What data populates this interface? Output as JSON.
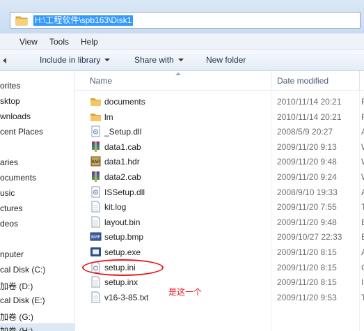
{
  "address": {
    "path": "H:\\工程软件\\spb163\\Disk1"
  },
  "menu": {
    "items": [
      "View",
      "Tools",
      "Help"
    ]
  },
  "toolbar": {
    "include_library": "Include in library",
    "share_with": "Share with",
    "new_folder": "New folder"
  },
  "nav": {
    "items": [
      "orites",
      "sktop",
      "wnloads",
      "cent Places",
      "aries",
      "ocuments",
      "usic",
      "ctures",
      "deos",
      "nputer",
      "cal Disk (C:)",
      "加卷 (D:)",
      "cal Disk (E:)",
      "加卷 (G:)",
      "加卷 (H:)"
    ],
    "selected_index": 14
  },
  "columns": {
    "name": "Name",
    "date": "Date modified"
  },
  "files": [
    {
      "name": "documents",
      "date": "2010/11/14 20:21",
      "type_letter": "F",
      "icon": "folder-icon"
    },
    {
      "name": "lm",
      "date": "2010/11/14 20:21",
      "type_letter": "F",
      "icon": "folder-icon"
    },
    {
      "name": "_Setup.dll",
      "date": "2008/5/9 20:27",
      "type_letter": "A",
      "icon": "dll-icon"
    },
    {
      "name": "data1.cab",
      "date": "2009/11/20 9:13",
      "type_letter": "W",
      "icon": "cab-archive-icon"
    },
    {
      "name": "data1.hdr",
      "date": "2009/11/20 9:48",
      "type_letter": "W",
      "icon": "hdr-archive-icon"
    },
    {
      "name": "data2.cab",
      "date": "2009/11/20 9:24",
      "type_letter": "W",
      "icon": "cab-archive-icon"
    },
    {
      "name": "ISSetup.dll",
      "date": "2008/9/10 19:33",
      "type_letter": "A",
      "icon": "dll-icon"
    },
    {
      "name": "kit.log",
      "date": "2009/11/20 7:55",
      "type_letter": "T",
      "icon": "text-file-icon"
    },
    {
      "name": "layout.bin",
      "date": "2009/11/20 9:48",
      "type_letter": "B",
      "icon": "text-file-icon"
    },
    {
      "name": "setup.bmp",
      "date": "2009/10/27 22:33",
      "type_letter": "B",
      "icon": "bitmap-icon"
    },
    {
      "name": "setup.exe",
      "date": "2009/11/20 8:15",
      "type_letter": "A",
      "icon": "exe-icon"
    },
    {
      "name": "setup.ini",
      "date": "2009/11/20 8:15",
      "type_letter": "C",
      "icon": "ini-file-icon"
    },
    {
      "name": "setup.inx",
      "date": "2009/11/20 8:15",
      "type_letter": "I",
      "icon": "text-file-icon"
    },
    {
      "name": "v16-3-85.txt",
      "date": "2009/11/20 9:53",
      "type_letter": "T",
      "icon": "text-file-icon"
    }
  ],
  "annotation": {
    "text": "是这一个",
    "color": "#e8161a"
  },
  "colors": {
    "selection": "#3399ff",
    "annotation": "#e8161a",
    "folder": "#e8b94a"
  }
}
